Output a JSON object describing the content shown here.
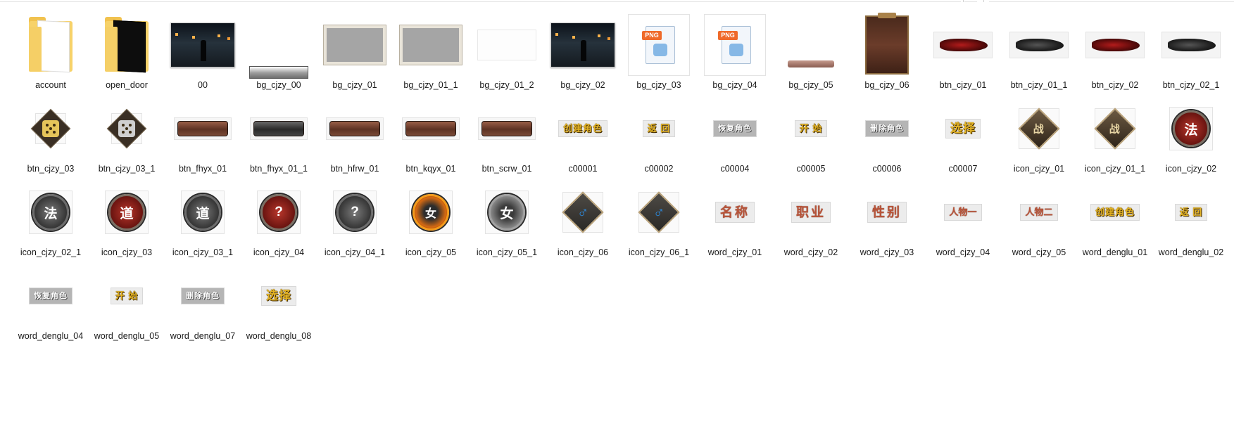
{
  "files": [
    {
      "name": "account",
      "thumb": "folder-light"
    },
    {
      "name": "open_door",
      "thumb": "folder-dark"
    },
    {
      "name": "00",
      "thumb": "scene"
    },
    {
      "name": "bg_cjzy_00",
      "thumb": "bar-gray"
    },
    {
      "name": "bg_cjzy_01",
      "thumb": "panel-gray"
    },
    {
      "name": "bg_cjzy_01_1",
      "thumb": "panel-gray"
    },
    {
      "name": "bg_cjzy_01_2",
      "thumb": "panel-white"
    },
    {
      "name": "bg_cjzy_02",
      "thumb": "scene"
    },
    {
      "name": "bg_cjzy_03",
      "thumb": "png-generic",
      "badge": "PNG"
    },
    {
      "name": "bg_cjzy_04",
      "thumb": "png-generic",
      "badge": "PNG"
    },
    {
      "name": "bg_cjzy_05",
      "thumb": "slim-bar"
    },
    {
      "name": "bg_cjzy_06",
      "thumb": "tall-panel"
    },
    {
      "name": "btn_cjzy_01",
      "thumb": "brush-red"
    },
    {
      "name": "btn_cjzy_01_1",
      "thumb": "brush-dark"
    },
    {
      "name": "btn_cjzy_02",
      "thumb": "brush-red"
    },
    {
      "name": "btn_cjzy_02_1",
      "thumb": "brush-dark"
    },
    {
      "name": "btn_cjzy_03",
      "thumb": "dice-gold"
    },
    {
      "name": "btn_cjzy_03_1",
      "thumb": "dice-gray"
    },
    {
      "name": "btn_fhyx_01",
      "thumb": "btnbar-brown"
    },
    {
      "name": "btn_fhyx_01_1",
      "thumb": "btnbar-black"
    },
    {
      "name": "btn_hfrw_01",
      "thumb": "btnbar-brown"
    },
    {
      "name": "btn_kqyx_01",
      "thumb": "btnbar-brown"
    },
    {
      "name": "btn_scrw_01",
      "thumb": "btnbar-brown"
    },
    {
      "name": "c00001",
      "thumb": "word",
      "text": "创建角色"
    },
    {
      "name": "c00002",
      "thumb": "word",
      "text": "返 回"
    },
    {
      "name": "c00004",
      "thumb": "word-gray",
      "text": "恢复角色"
    },
    {
      "name": "c00005",
      "thumb": "word",
      "text": "开 始"
    },
    {
      "name": "c00006",
      "thumb": "word-gray",
      "text": "删除角色"
    },
    {
      "name": "c00007",
      "thumb": "word-big",
      "text": "选择"
    },
    {
      "name": "icon_cjzy_01",
      "thumb": "diamond",
      "text": "战"
    },
    {
      "name": "icon_cjzy_01_1",
      "thumb": "diamond",
      "text": "战"
    },
    {
      "name": "icon_cjzy_02",
      "thumb": "round-red",
      "text": "法"
    },
    {
      "name": "icon_cjzy_02_1",
      "thumb": "round-dark",
      "text": "法"
    },
    {
      "name": "icon_cjzy_03",
      "thumb": "round-red",
      "text": "道"
    },
    {
      "name": "icon_cjzy_03_1",
      "thumb": "round-dark",
      "text": "道"
    },
    {
      "name": "icon_cjzy_04",
      "thumb": "round-red",
      "text": "?"
    },
    {
      "name": "icon_cjzy_04_1",
      "thumb": "round-dark",
      "text": "?"
    },
    {
      "name": "icon_cjzy_05",
      "thumb": "round-fire",
      "text": "女"
    },
    {
      "name": "icon_cjzy_05_1",
      "thumb": "round-dark2",
      "text": "女"
    },
    {
      "name": "icon_cjzy_06",
      "thumb": "diamond-blue",
      "text": "♂"
    },
    {
      "name": "icon_cjzy_06_1",
      "thumb": "diamond-blue",
      "text": "♂"
    },
    {
      "name": "word_cjzy_01",
      "thumb": "word-red",
      "text": "名称"
    },
    {
      "name": "word_cjzy_02",
      "thumb": "word-red",
      "text": "职业"
    },
    {
      "name": "word_cjzy_03",
      "thumb": "word-red",
      "text": "性别"
    },
    {
      "name": "word_cjzy_04",
      "thumb": "word-red-sm",
      "text": "人物一"
    },
    {
      "name": "word_cjzy_05",
      "thumb": "word-red-sm",
      "text": "人物二"
    },
    {
      "name": "word_denglu_01",
      "thumb": "word",
      "text": "创建角色"
    },
    {
      "name": "word_denglu_02",
      "thumb": "word",
      "text": "返 回"
    },
    {
      "name": "word_denglu_04",
      "thumb": "word-gray",
      "text": "恢复角色"
    },
    {
      "name": "word_denglu_05",
      "thumb": "word",
      "text": "开 始"
    },
    {
      "name": "word_denglu_07",
      "thumb": "word-gray",
      "text": "删除角色"
    },
    {
      "name": "word_denglu_08",
      "thumb": "word-big",
      "text": "选择"
    }
  ]
}
